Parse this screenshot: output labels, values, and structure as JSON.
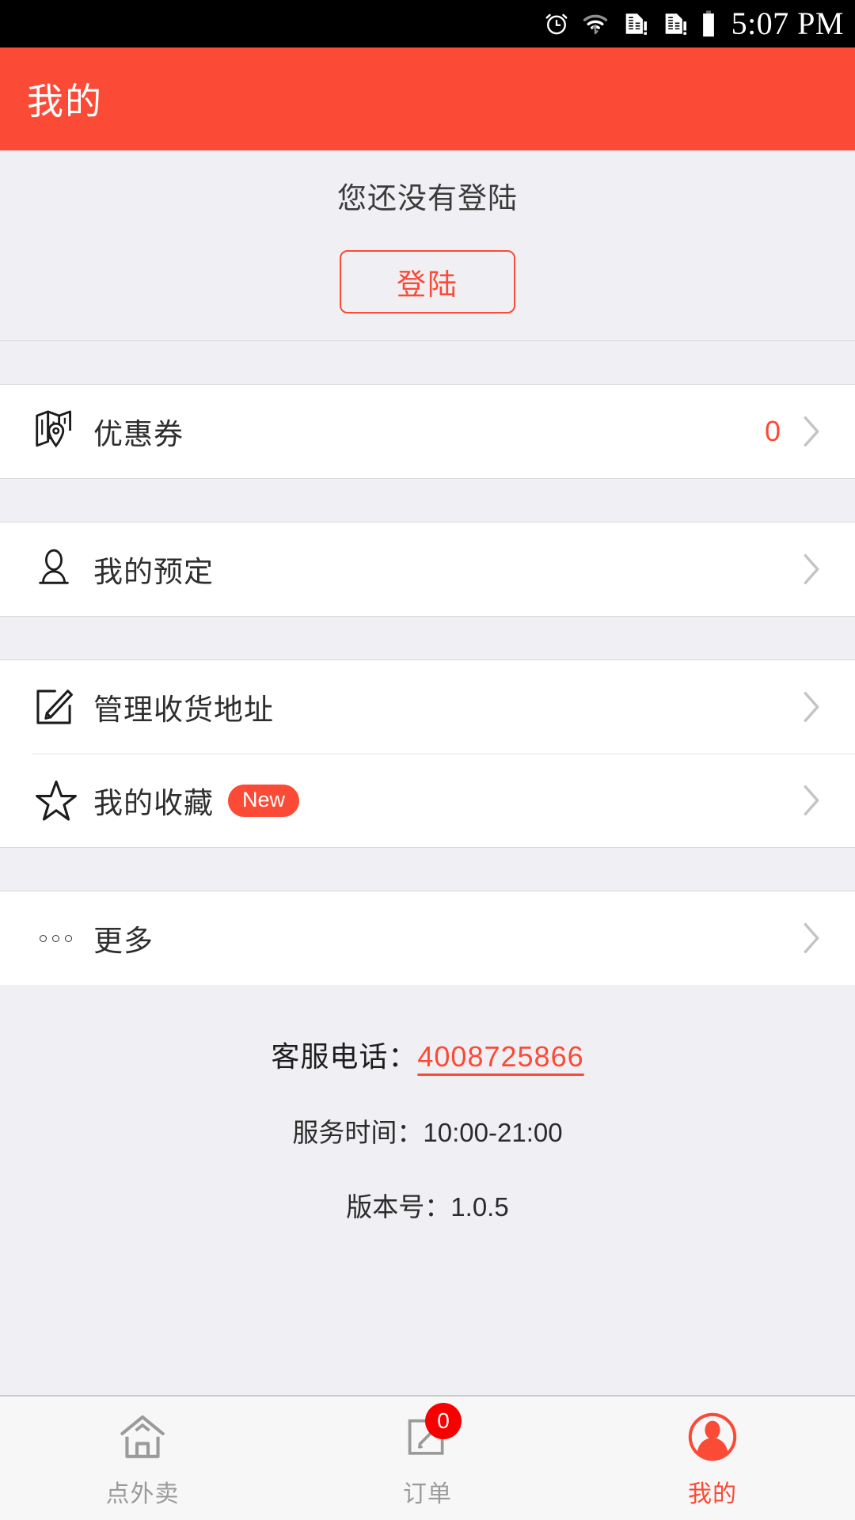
{
  "status_bar": {
    "time": "5:07 PM",
    "icons": [
      "alarm-icon",
      "wifi-icon",
      "sim1-signal-icon",
      "sim2-signal-icon",
      "battery-icon"
    ]
  },
  "header": {
    "title": "我的"
  },
  "login": {
    "message": "您还没有登陆",
    "button_label": "登陆"
  },
  "menu_groups": [
    {
      "rows": [
        {
          "icon": "map-pin-icon",
          "label": "优惠券",
          "count": "0",
          "badge": "",
          "chevron": "chevron-right-icon"
        }
      ]
    },
    {
      "rows": [
        {
          "icon": "person-outline-icon",
          "label": "我的预定",
          "count": "",
          "badge": "",
          "chevron": "chevron-right-icon"
        }
      ]
    },
    {
      "rows": [
        {
          "icon": "edit-square-icon",
          "label": "管理收货地址",
          "count": "",
          "badge": "",
          "chevron": "chevron-right-icon"
        },
        {
          "icon": "star-outline-icon",
          "label": "我的收藏",
          "count": "",
          "badge": "New",
          "chevron": "chevron-right-icon"
        }
      ]
    },
    {
      "rows": [
        {
          "icon": "ellipsis-icon",
          "label": "更多",
          "count": "",
          "badge": "",
          "chevron": "chevron-right-icon"
        }
      ]
    }
  ],
  "footer": {
    "phone_label": "客服电话：",
    "phone_number": "4008725866",
    "service_hours": "服务时间：10:00-21:00",
    "version": "版本号：1.0.5"
  },
  "tabbar": {
    "tabs": [
      {
        "icon": "home-icon",
        "label": "点外卖",
        "badge": "",
        "active": false
      },
      {
        "icon": "order-icon",
        "label": "订单",
        "badge": "0",
        "active": false
      },
      {
        "icon": "user-circle-icon",
        "label": "我的",
        "badge": "",
        "active": true
      }
    ]
  },
  "colors": {
    "accent": "#fb4a36",
    "badge_red": "#f90000",
    "page_bg": "#f0f0f4",
    "row_bg": "#ffffff",
    "muted": "#9a9a9a"
  }
}
